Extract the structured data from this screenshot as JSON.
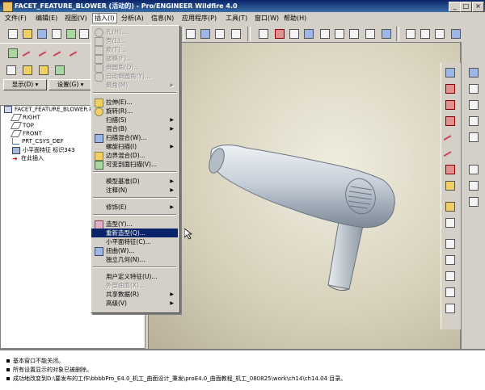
{
  "window": {
    "title": "FACET_FEATURE_BLOWER (活动的) - Pro/ENGINEER Wildfire 4.0",
    "minimize": "_",
    "maximize": "□",
    "close": "×"
  },
  "menubar": [
    {
      "label": "文件(F)"
    },
    {
      "label": "编辑(E)"
    },
    {
      "label": "视图(V)"
    },
    {
      "label": "插入(I)"
    },
    {
      "label": "分析(A)"
    },
    {
      "label": "信息(N)"
    },
    {
      "label": "应用程序(P)"
    },
    {
      "label": "工具(T)"
    },
    {
      "label": "窗口(W)"
    },
    {
      "label": "帮助(H)"
    }
  ],
  "left_panel": {
    "show_button": "显示(D) ▾",
    "settings_button": "设置(G) ▾",
    "tree_items": [
      {
        "label": "FACET_FEATURE_BLOWER.PRT",
        "icon": "part-icon"
      },
      {
        "label": "RIGHT",
        "icon": "datum-plane-icon"
      },
      {
        "label": "TOP",
        "icon": "datum-plane-icon"
      },
      {
        "label": "FRONT",
        "icon": "datum-plane-icon"
      },
      {
        "label": "PRT_CSYS_DEF",
        "icon": "csys-icon"
      },
      {
        "label": "小平面特征 标识343",
        "icon": "facet-feature-icon"
      },
      {
        "label": "在此插入",
        "icon": "insert-here-arrow-icon"
      }
    ]
  },
  "insert_menu": {
    "items": [
      {
        "label": "孔(H)...",
        "disabled": true,
        "icon": "hole-icon"
      },
      {
        "label": "壳(L)...",
        "disabled": true,
        "icon": "shell-icon"
      },
      {
        "label": "筋(T)...",
        "disabled": true,
        "icon": "rib-icon"
      },
      {
        "label": "拔模(F)...",
        "disabled": true,
        "icon": "draft-icon"
      },
      {
        "label": "倒圆角(O)...",
        "disabled": true,
        "icon": "round-icon"
      },
      {
        "label": "自动倒圆角(Y)...",
        "disabled": true,
        "icon": "auto-round-icon"
      },
      {
        "label": "倒角(M)",
        "disabled": true,
        "submenu": true,
        "icon": ""
      },
      {
        "label": "拉伸(E)...",
        "disabled": false,
        "icon": "extrude-icon"
      },
      {
        "label": "旋转(R)...",
        "disabled": false,
        "icon": "revolve-icon"
      },
      {
        "label": "扫描(S)",
        "disabled": false,
        "submenu": true,
        "icon": ""
      },
      {
        "label": "混合(B)",
        "disabled": false,
        "submenu": true,
        "icon": ""
      },
      {
        "label": "扫描混合(W)...",
        "disabled": false,
        "icon": "swept-blend-icon"
      },
      {
        "label": "螺旋扫描(I)",
        "disabled": false,
        "submenu": true,
        "icon": ""
      },
      {
        "label": "边界混合(D)...",
        "disabled": false,
        "icon": "boundary-blend-icon"
      },
      {
        "label": "可变剖面扫描(V)...",
        "disabled": false,
        "icon": "variable-section-sweep-icon"
      },
      {
        "label": "模型基准(D)",
        "disabled": false,
        "submenu": true,
        "icon": ""
      },
      {
        "label": "注释(N)",
        "disabled": false,
        "submenu": true,
        "icon": ""
      },
      {
        "label": "修饰(E)",
        "disabled": false,
        "submenu": true,
        "icon": ""
      },
      {
        "label": "造型(Y)...",
        "disabled": false,
        "icon": "style-icon"
      },
      {
        "label": "重新造型(Q)...",
        "disabled": false,
        "highlighted": true,
        "icon": ""
      },
      {
        "label": "小平面特征(C)...",
        "disabled": false,
        "icon": ""
      },
      {
        "label": "扭曲(W)...",
        "disabled": false,
        "icon": "warp-icon"
      },
      {
        "label": "独立几何(N)...",
        "disabled": false,
        "icon": ""
      },
      {
        "label": "用户定义特征(U)...",
        "disabled": false,
        "icon": ""
      },
      {
        "label": "外部曲面(X)...",
        "disabled": true,
        "icon": ""
      },
      {
        "label": "共享数据(R)",
        "disabled": false,
        "submenu": true,
        "icon": ""
      },
      {
        "label": "高级(V)",
        "disabled": false,
        "submenu": true,
        "icon": ""
      }
    ]
  },
  "messages": [
    "基本窗口不能关闭。",
    "所有设置显示的对象已被删除。",
    "成功地改变到D:\\要发布的工作\\bbbbPro_E4.0_机工_曲面设计_秉发\\proE4.0_曲面教程_机工_080825\\work\\ch14\\ch14.04 目录。"
  ],
  "colors": {
    "title_bar": "#0a246a",
    "menu_highlight": "#0a246a",
    "model_surface": "#c8d0da",
    "viewport_bg": "#d8d2bc"
  }
}
